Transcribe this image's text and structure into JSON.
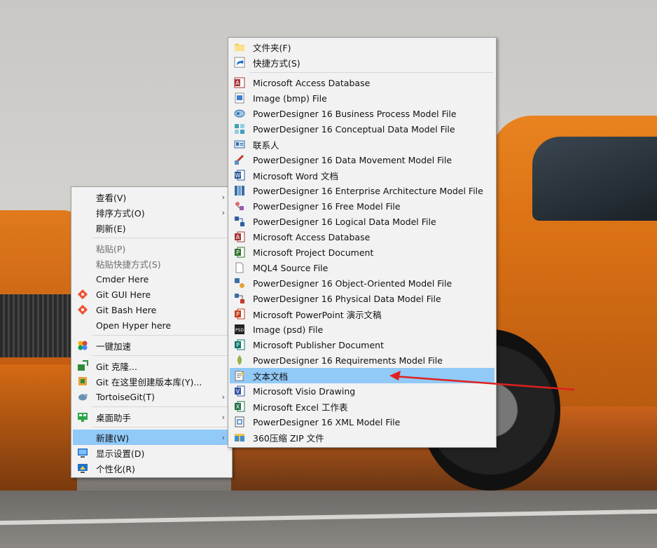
{
  "context_menu": {
    "items": [
      {
        "label": "查看(V)",
        "submenu": true,
        "disabled": false
      },
      {
        "label": "排序方式(O)",
        "submenu": true,
        "disabled": false
      },
      {
        "label": "刷新(E)",
        "submenu": false,
        "disabled": false
      },
      {
        "label": "粘贴(P)",
        "submenu": false,
        "disabled": true
      },
      {
        "label": "粘贴快捷方式(S)",
        "submenu": false,
        "disabled": true
      },
      {
        "label": "Cmder Here",
        "submenu": false,
        "disabled": false
      },
      {
        "label": "Git GUI Here",
        "submenu": false,
        "disabled": false,
        "icon": "git-icon"
      },
      {
        "label": "Git Bash Here",
        "submenu": false,
        "disabled": false,
        "icon": "git-icon"
      },
      {
        "label": "Open Hyper here",
        "submenu": false,
        "disabled": false
      },
      {
        "label": "一键加速",
        "submenu": false,
        "disabled": false,
        "icon": "speedup-icon"
      },
      {
        "label": "Git 克隆...",
        "submenu": false,
        "disabled": false,
        "icon": "tortoisegit-clone-icon"
      },
      {
        "label": "Git 在这里创建版本库(Y)...",
        "submenu": false,
        "disabled": false,
        "icon": "tortoisegit-create-icon"
      },
      {
        "label": "TortoiseGit(T)",
        "submenu": true,
        "disabled": false,
        "icon": "tortoisegit-icon"
      },
      {
        "label": "桌面助手",
        "submenu": true,
        "disabled": false,
        "icon": "desktop-helper-icon"
      },
      {
        "label": "新建(W)",
        "submenu": true,
        "disabled": false,
        "highlighted": true
      },
      {
        "label": "显示设置(D)",
        "submenu": false,
        "disabled": false,
        "icon": "display-settings-icon"
      },
      {
        "label": "个性化(R)",
        "submenu": false,
        "disabled": false,
        "icon": "personalize-icon"
      }
    ]
  },
  "new_submenu": {
    "items": [
      {
        "label": "文件夹(F)",
        "icon": "folder-icon"
      },
      {
        "label": "快捷方式(S)",
        "icon": "shortcut-icon"
      },
      {
        "label": "Microsoft Access Database",
        "icon": "access-icon"
      },
      {
        "label": "Image (bmp) File",
        "icon": "bmp-icon"
      },
      {
        "label": "PowerDesigner 16 Business Process Model File",
        "icon": "pd-bpm-icon"
      },
      {
        "label": "PowerDesigner 16 Conceptual Data Model File",
        "icon": "pd-cdm-icon"
      },
      {
        "label": "联系人",
        "icon": "contact-icon"
      },
      {
        "label": "PowerDesigner 16 Data Movement Model File",
        "icon": "pd-dmm-icon"
      },
      {
        "label": "Microsoft Word 文档",
        "icon": "word-icon"
      },
      {
        "label": "PowerDesigner 16 Enterprise Architecture Model File",
        "icon": "pd-eam-icon"
      },
      {
        "label": "PowerDesigner 16 Free Model File",
        "icon": "pd-free-icon"
      },
      {
        "label": "PowerDesigner 16 Logical Data Model File",
        "icon": "pd-ldm-icon"
      },
      {
        "label": "Microsoft Access Database",
        "icon": "access-icon"
      },
      {
        "label": "Microsoft Project Document",
        "icon": "project-icon"
      },
      {
        "label": "MQL4 Source File",
        "icon": "file-icon"
      },
      {
        "label": "PowerDesigner 16 Object-Oriented Model File",
        "icon": "pd-oom-icon"
      },
      {
        "label": "PowerDesigner 16 Physical Data Model File",
        "icon": "pd-pdm-icon"
      },
      {
        "label": "Microsoft PowerPoint 演示文稿",
        "icon": "powerpoint-icon"
      },
      {
        "label": "Image (psd) File",
        "icon": "psd-icon"
      },
      {
        "label": "Microsoft Publisher Document",
        "icon": "publisher-icon"
      },
      {
        "label": "PowerDesigner 16 Requirements Model File",
        "icon": "pd-rqm-icon"
      },
      {
        "label": "文本文档",
        "icon": "text-document-icon",
        "highlighted": true
      },
      {
        "label": "Microsoft Visio Drawing",
        "icon": "visio-icon"
      },
      {
        "label": "Microsoft Excel 工作表",
        "icon": "excel-icon"
      },
      {
        "label": "PowerDesigner 16 XML Model File",
        "icon": "pd-xml-icon"
      },
      {
        "label": "360压缩 ZIP 文件",
        "icon": "zip-icon"
      }
    ]
  },
  "colors": {
    "highlight": "#91c9f7",
    "annotation_arrow": "#e02020"
  }
}
